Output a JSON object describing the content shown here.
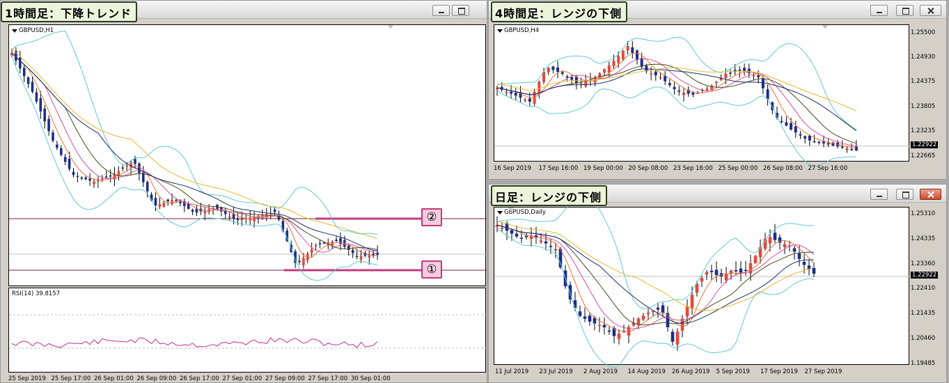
{
  "windows": {
    "h1": {
      "title": "1時間足：下降トレンド",
      "symbol_label": "GBPUSD,H1",
      "rsi_label": "RSI(14) 39.8157",
      "x_labels": [
        "25 Sep 2019",
        "25 Sep 17:00",
        "26 Sep 01:00",
        "26 Sep 09:00",
        "26 Sep 17:00",
        "27 Sep 01:00",
        "27 Sep 09:00",
        "27 Sep 17:00",
        "30 Sep 01:00"
      ],
      "marker_upper": "②",
      "marker_lower": "①"
    },
    "h4": {
      "title": "4時間足：レンジの下側",
      "symbol_label": "GBPUSD,H4",
      "x_labels": [
        "16 Sep 2019",
        "17 Sep 16:00",
        "19 Sep 00:00",
        "20 Sep 08:00",
        "23 Sep 16:00",
        "25 Sep 00:00",
        "26 Sep 08:00",
        "27 Sep 16:00"
      ],
      "y_labels": [
        "1.25500",
        "1.24930",
        "1.24375",
        "1.23805",
        "1.23235",
        "1.22922",
        "1.22665"
      ]
    },
    "daily": {
      "title": "日足：レンジの下側",
      "symbol_label": "GBPUSD,Daily",
      "x_labels": [
        "11 Jul 2019",
        "23 Jul 2019",
        "2 Aug 2019",
        "14 Aug 2019",
        "26 Aug 2019",
        "5 Sep 2019",
        "17 Sep 2019",
        "27 Sep 2019"
      ],
      "y_labels": [
        "1.25310",
        "1.24335",
        "1.23360",
        "1.22922",
        "1.22410",
        "1.21435",
        "1.20460",
        "1.19485"
      ]
    }
  },
  "colors": {
    "bull": "#e8473a",
    "bear": "#1a2e8c",
    "bollinger": "#5fc8d4",
    "ma_fast": "#e8733a",
    "ma_mid": "#d4509a",
    "ma_slow": "#1a2e6e",
    "ma_olive": "#4a4a1a",
    "ma_gold": "#e6b830",
    "rsi": "#c0308a",
    "hline": "#c23b7c"
  },
  "chart_data": [
    {
      "type": "candlestick",
      "title": "1時間足：下降トレンド",
      "symbol": "GBPUSD,H1",
      "x": [
        "25 Sep 2019",
        "25 Sep 17:00",
        "26 Sep 01:00",
        "26 Sep 09:00",
        "26 Sep 17:00",
        "27 Sep 01:00",
        "27 Sep 09:00",
        "27 Sep 17:00",
        "30 Sep 01:00"
      ],
      "series": [
        {
          "close": [
            1.2495,
            1.246,
            1.24,
            1.2385,
            1.2378,
            1.238,
            1.231,
            1.2296,
            1.2292
          ]
        }
      ],
      "horizontal_lines": [
        {
          "label": "②",
          "value": 1.2345
        },
        {
          "label": "①",
          "value": 1.2295
        }
      ],
      "rsi": {
        "period": 14,
        "last": 39.8157,
        "levels": [
          70,
          30
        ]
      }
    },
    {
      "type": "candlestick",
      "title": "4時間足：レンジの下側",
      "symbol": "GBPUSD,H4",
      "x": [
        "16 Sep 2019",
        "17 Sep 16:00",
        "19 Sep 00:00",
        "20 Sep 08:00",
        "23 Sep 16:00",
        "25 Sep 00:00",
        "26 Sep 08:00",
        "27 Sep 16:00"
      ],
      "ylim": [
        1.2255,
        1.257
      ],
      "ticks": [
        1.255,
        1.2493,
        1.24375,
        1.23805,
        1.23235,
        1.22665
      ],
      "last_price": 1.22922
    },
    {
      "type": "candlestick",
      "title": "日足：レンジの下側",
      "symbol": "GBPUSD,Daily",
      "x": [
        "11 Jul 2019",
        "23 Jul 2019",
        "2 Aug 2019",
        "14 Aug 2019",
        "26 Aug 2019",
        "5 Sep 2019",
        "17 Sep 2019",
        "27 Sep 2019"
      ],
      "ylim": [
        1.1945,
        1.256
      ],
      "ticks": [
        1.2531,
        1.24335,
        1.2336,
        1.2241,
        1.21435,
        1.2046,
        1.19485
      ],
      "last_price": 1.22922
    }
  ]
}
